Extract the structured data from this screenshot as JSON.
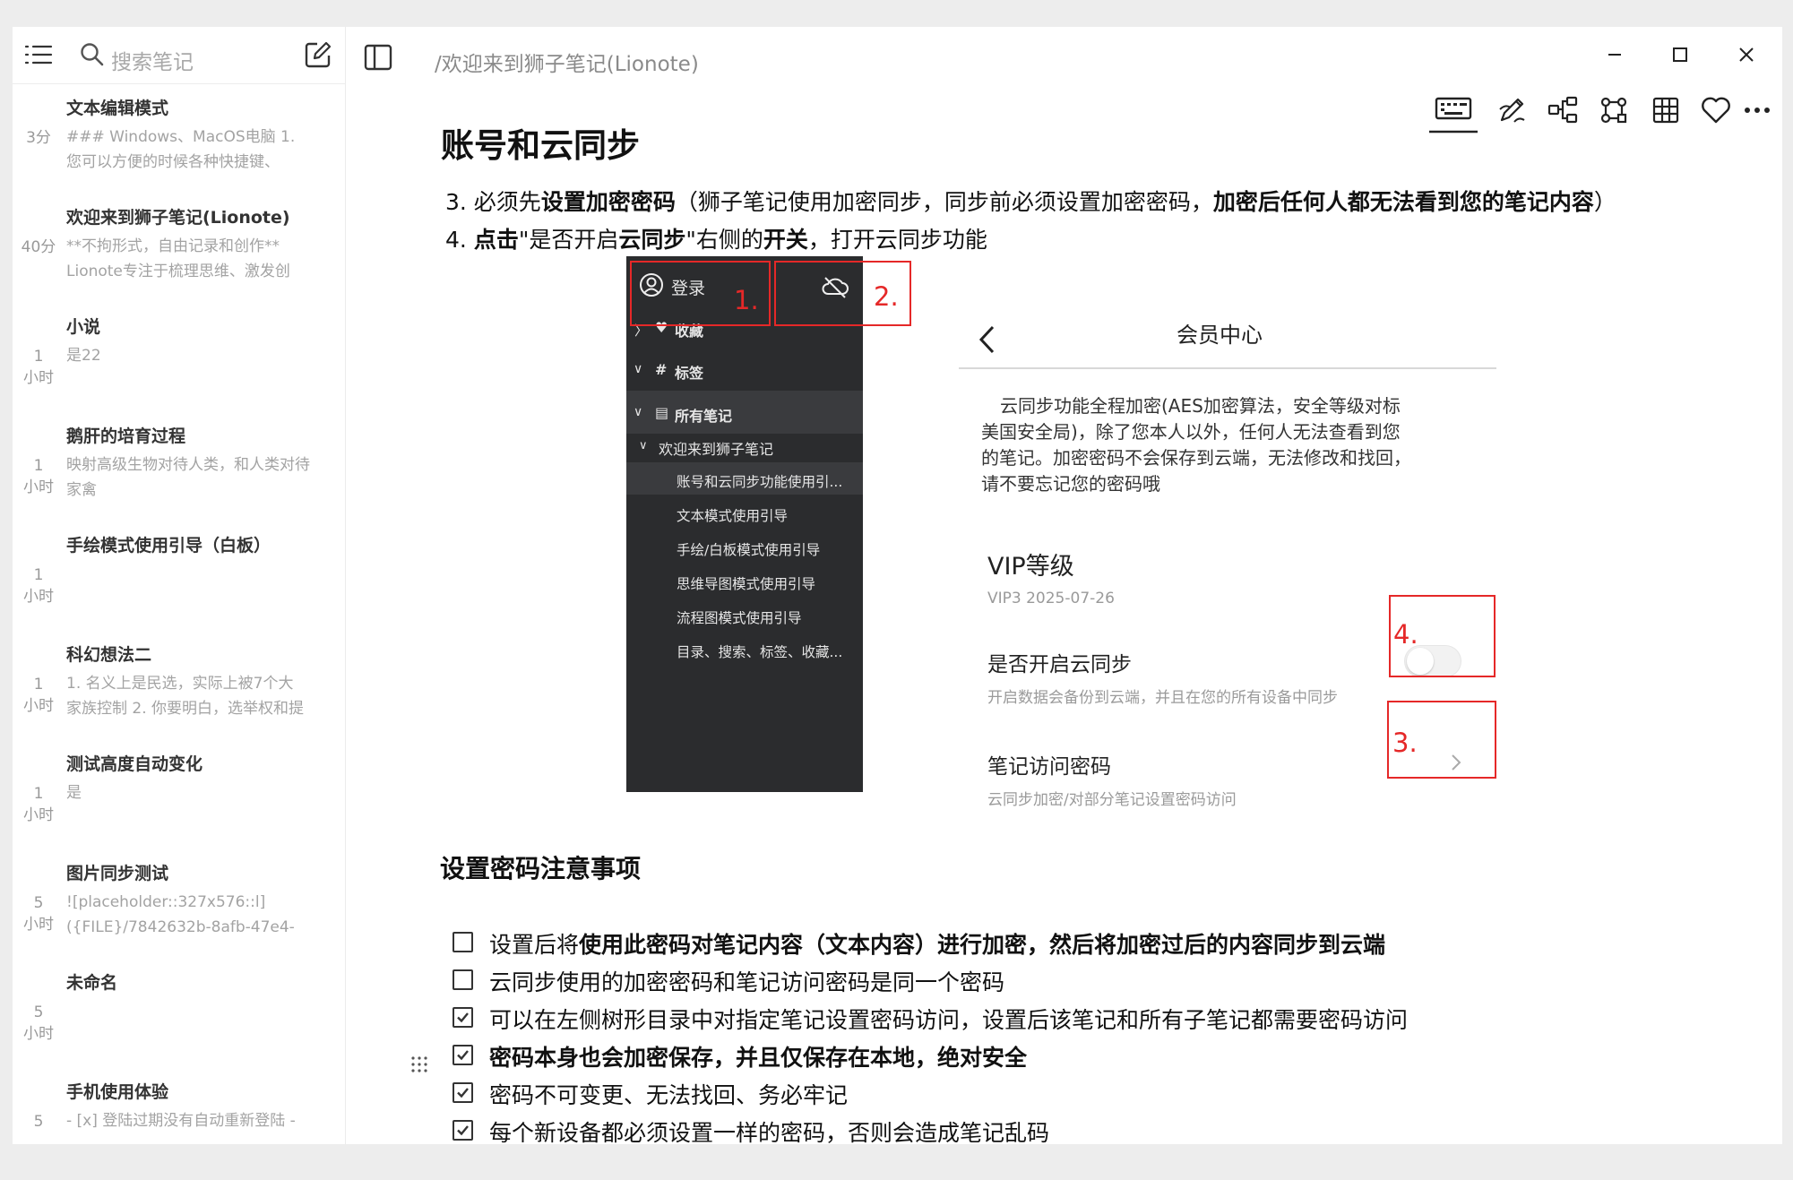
{
  "sidebar": {
    "search_placeholder": "搜索笔记",
    "notes": [
      {
        "title": "文本编辑模式",
        "time": [
          "3分"
        ],
        "preview": [
          "### Windows、MacOS电脑  1.",
          "您可以方便的时候各种快捷键、"
        ]
      },
      {
        "title": "欢迎来到狮子笔记(Lionote)",
        "time": [
          "40分"
        ],
        "preview": [
          "   **不拘形式，自由记录和创作**",
          "Lionote专注于梳理思维、激发创"
        ]
      },
      {
        "title": "小说",
        "time": [
          "1",
          "小时"
        ],
        "preview": [
          "是22"
        ]
      },
      {
        "title": "鹅肝的培育过程",
        "time": [
          "1",
          "小时"
        ],
        "preview": [
          "映射高级生物对待人类，和人类对待",
          "家禽"
        ]
      },
      {
        "title": "手绘模式使用引导（白板）",
        "time": [
          "1",
          "小时"
        ],
        "preview": []
      },
      {
        "title": "科幻想法二",
        "time": [
          "1",
          "小时"
        ],
        "preview": [
          "  1. 名义上是民选，实际上被7个大",
          "家族控制  2. 你要明白，选举权和提"
        ]
      },
      {
        "title": "测试高度自动变化",
        "time": [
          "1",
          "小时"
        ],
        "preview": [
          "是"
        ]
      },
      {
        "title": "图片同步测试",
        "time": [
          "5",
          "小时"
        ],
        "preview": [
          "![placeholder::327x576::l]",
          "({FILE}/7842632b-8afb-47e4-"
        ]
      },
      {
        "title": "未命名",
        "time": [
          "5",
          "小时"
        ],
        "preview": []
      },
      {
        "title": "手机使用体验",
        "time": [
          "5"
        ],
        "preview": [
          "- [x] 登陆过期没有自动重新登陆  -"
        ]
      }
    ]
  },
  "main": {
    "path": "/欢迎来到狮子笔记(Lionote)",
    "title": "账号和云同步",
    "step3": {
      "a": "3. 必须先",
      "b": "设置加密密码",
      "c": "（狮子笔记使用加密同步，同步前必须设置加密密码，",
      "d": "加密后任何人都无法看到您的笔记内容",
      "e": "）"
    },
    "step4": {
      "a": "4. ",
      "b": "点击",
      "c": "\"是否开启",
      "d": "云同步",
      "e": "\"右侧的",
      "f": "开关",
      "g": "，打开云同步功能"
    },
    "screenshot_left": {
      "login": "登录",
      "fav": "收藏",
      "tags": "标签",
      "all": "所有笔记",
      "folder": "欢迎来到狮子笔记",
      "items": [
        "账号和云同步功能使用引...",
        "文本模式使用引导",
        "手绘/白板模式使用引导",
        "思维导图模式使用引导",
        "流程图模式使用引导",
        "目录、搜索、标签、收藏..."
      ]
    },
    "screenshot_right": {
      "header": "会员中心",
      "desc": [
        "云同步功能全程加密(AES加密算法，安全等级对标",
        "美国安全局)，除了您本人以外，任何人无法查看到您",
        "的笔记。加密密码不会保存到云端，无法修改和找回，",
        "请不要忘记您的密码哦"
      ],
      "vip_title": "VIP等级",
      "vip_value": "VIP3 2025-07-26",
      "sync_title": "是否开启云同步",
      "sync_desc": "开启数据会备份到云端，并且在您的所有设备中同步",
      "pwd_title": "笔记访问密码",
      "pwd_desc": "云同步加密/对部分笔记设置密码访问"
    },
    "markers": [
      "1.",
      "2.",
      "3.",
      "4."
    ],
    "notice_title": "设置密码注意事项",
    "checklist": [
      {
        "checked": false,
        "pre": "设置后将",
        "bold": "使用此密码对笔记内容（文本内容）进行加密，然后将加密过后的内容同步到云端",
        "post": ""
      },
      {
        "checked": false,
        "pre": "云同步使用的加密密码和笔记访问密码是同一个密码",
        "bold": "",
        "post": ""
      },
      {
        "checked": true,
        "pre": "可以在左侧树形目录中对指定笔记设置密码访问，设置后该笔记和所有子笔记都需要密码访问",
        "bold": "",
        "post": ""
      },
      {
        "checked": true,
        "pre": "",
        "bold": "密码本身也会加密保存，并且仅保存在本地，绝对安全",
        "post": ""
      },
      {
        "checked": true,
        "pre": "密码不可变更、无法找回、务必牢记",
        "bold": "",
        "post": ""
      },
      {
        "checked": true,
        "pre": "每个新设备都必须设置一样的密码，否则会造成笔记乱码",
        "bold": "",
        "post": ""
      }
    ]
  },
  "colors": {
    "accent_red": "#e52828",
    "dark_panel": "#2b2c2e"
  },
  "icons": [
    "list-icon",
    "search-icon",
    "new-note-icon",
    "sidebar-toggle-icon",
    "minimize-icon",
    "maximize-icon",
    "close-icon",
    "keyboard-icon",
    "draw-icon",
    "mindmap-icon",
    "flowchart-icon",
    "table-icon",
    "heart-icon",
    "more-icon"
  ]
}
